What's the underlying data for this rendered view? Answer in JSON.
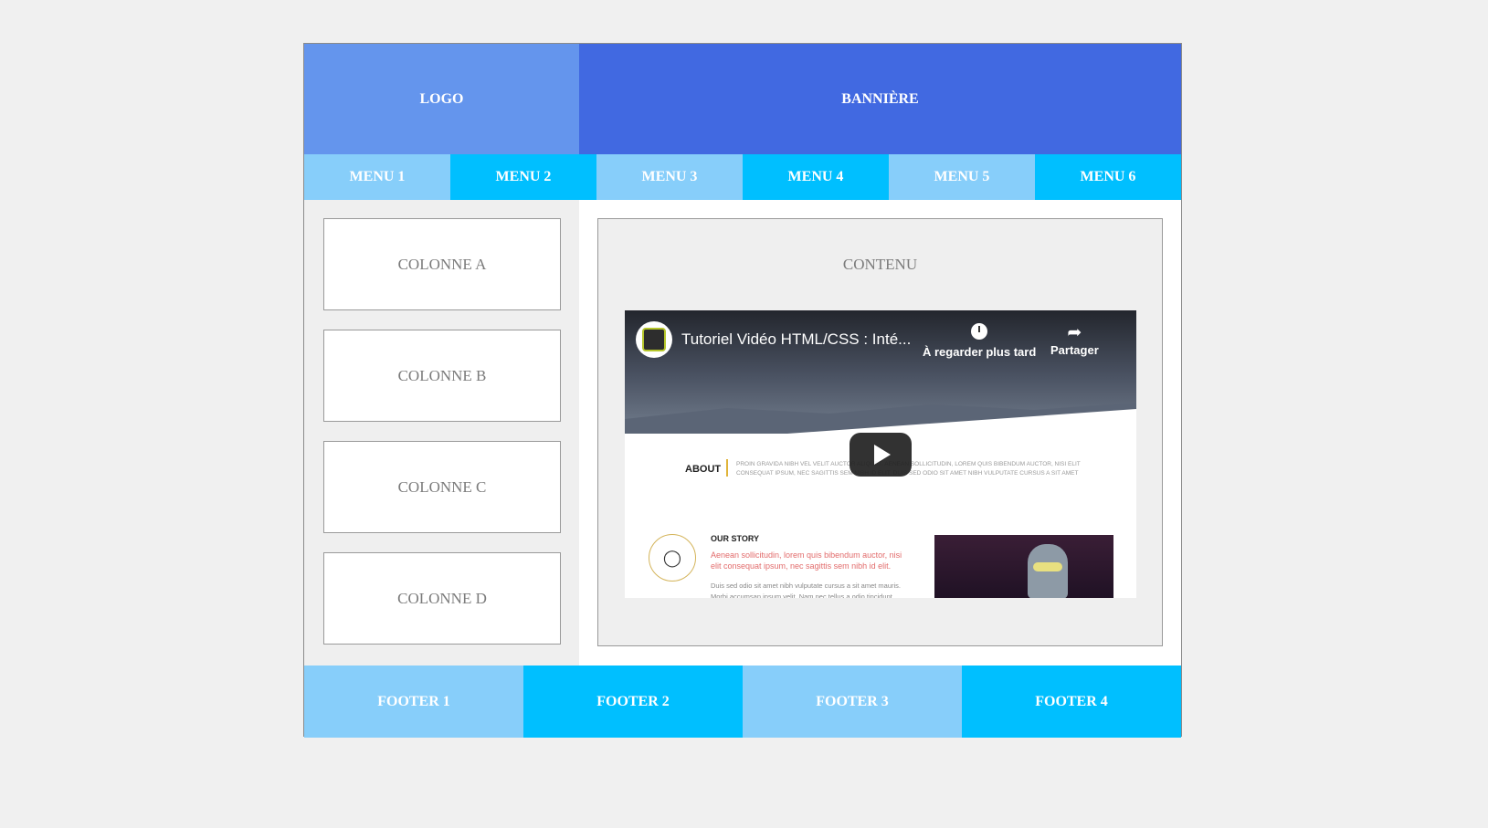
{
  "header": {
    "logo": "LOGO",
    "banner": "BANNIÈRE"
  },
  "nav": [
    {
      "label": "MENU 1"
    },
    {
      "label": "MENU 2"
    },
    {
      "label": "MENU 3"
    },
    {
      "label": "MENU 4"
    },
    {
      "label": "MENU 5"
    },
    {
      "label": "MENU 6"
    }
  ],
  "sidebar": [
    {
      "label": "COLONNE A"
    },
    {
      "label": "COLONNE B"
    },
    {
      "label": "COLONNE C"
    },
    {
      "label": "COLONNE D"
    }
  ],
  "content": {
    "title": "CONTENU",
    "video": {
      "title": "Tutoriel Vidéo HTML/CSS : Inté...",
      "watch_later": "À regarder plus tard",
      "share": "Partager",
      "about_heading": "ABOUT",
      "about_text": "PROIN GRAVIDA NIBH VEL VELIT AUCTOR ALIQUET. AENEAN SOLLICITUDIN, LOREM QUIS BIBENDUM AUCTOR, NISI ELIT CONSEQUAT IPSUM, NEC SAGITTIS SEM NIBH ID ELIT. DUIS SED ODIO SIT AMET NIBH VULPUTATE CURSUS A SIT AMET",
      "story_heading": "OUR STORY",
      "story_red": "Aenean sollicitudin, lorem quis bibendum auctor, nisi elit consequat ipsum, nec sagittis sem nibh id elit.",
      "story_grey": "Duis sed odio sit amet nibh vulputate cursus a sit amet mauris. Morbi accumsan ipsum velit. Nam nec tellus a odio tincidunt"
    }
  },
  "footer": [
    {
      "label": "FOOTER 1"
    },
    {
      "label": "FOOTER 2"
    },
    {
      "label": "FOOTER 3"
    },
    {
      "label": "FOOTER 4"
    }
  ],
  "colors": {
    "logo": "#6495ed",
    "banner": "#4169e1",
    "light": "#87cefa",
    "dark": "#00bfff",
    "page_bg": "#f0f0f0"
  }
}
